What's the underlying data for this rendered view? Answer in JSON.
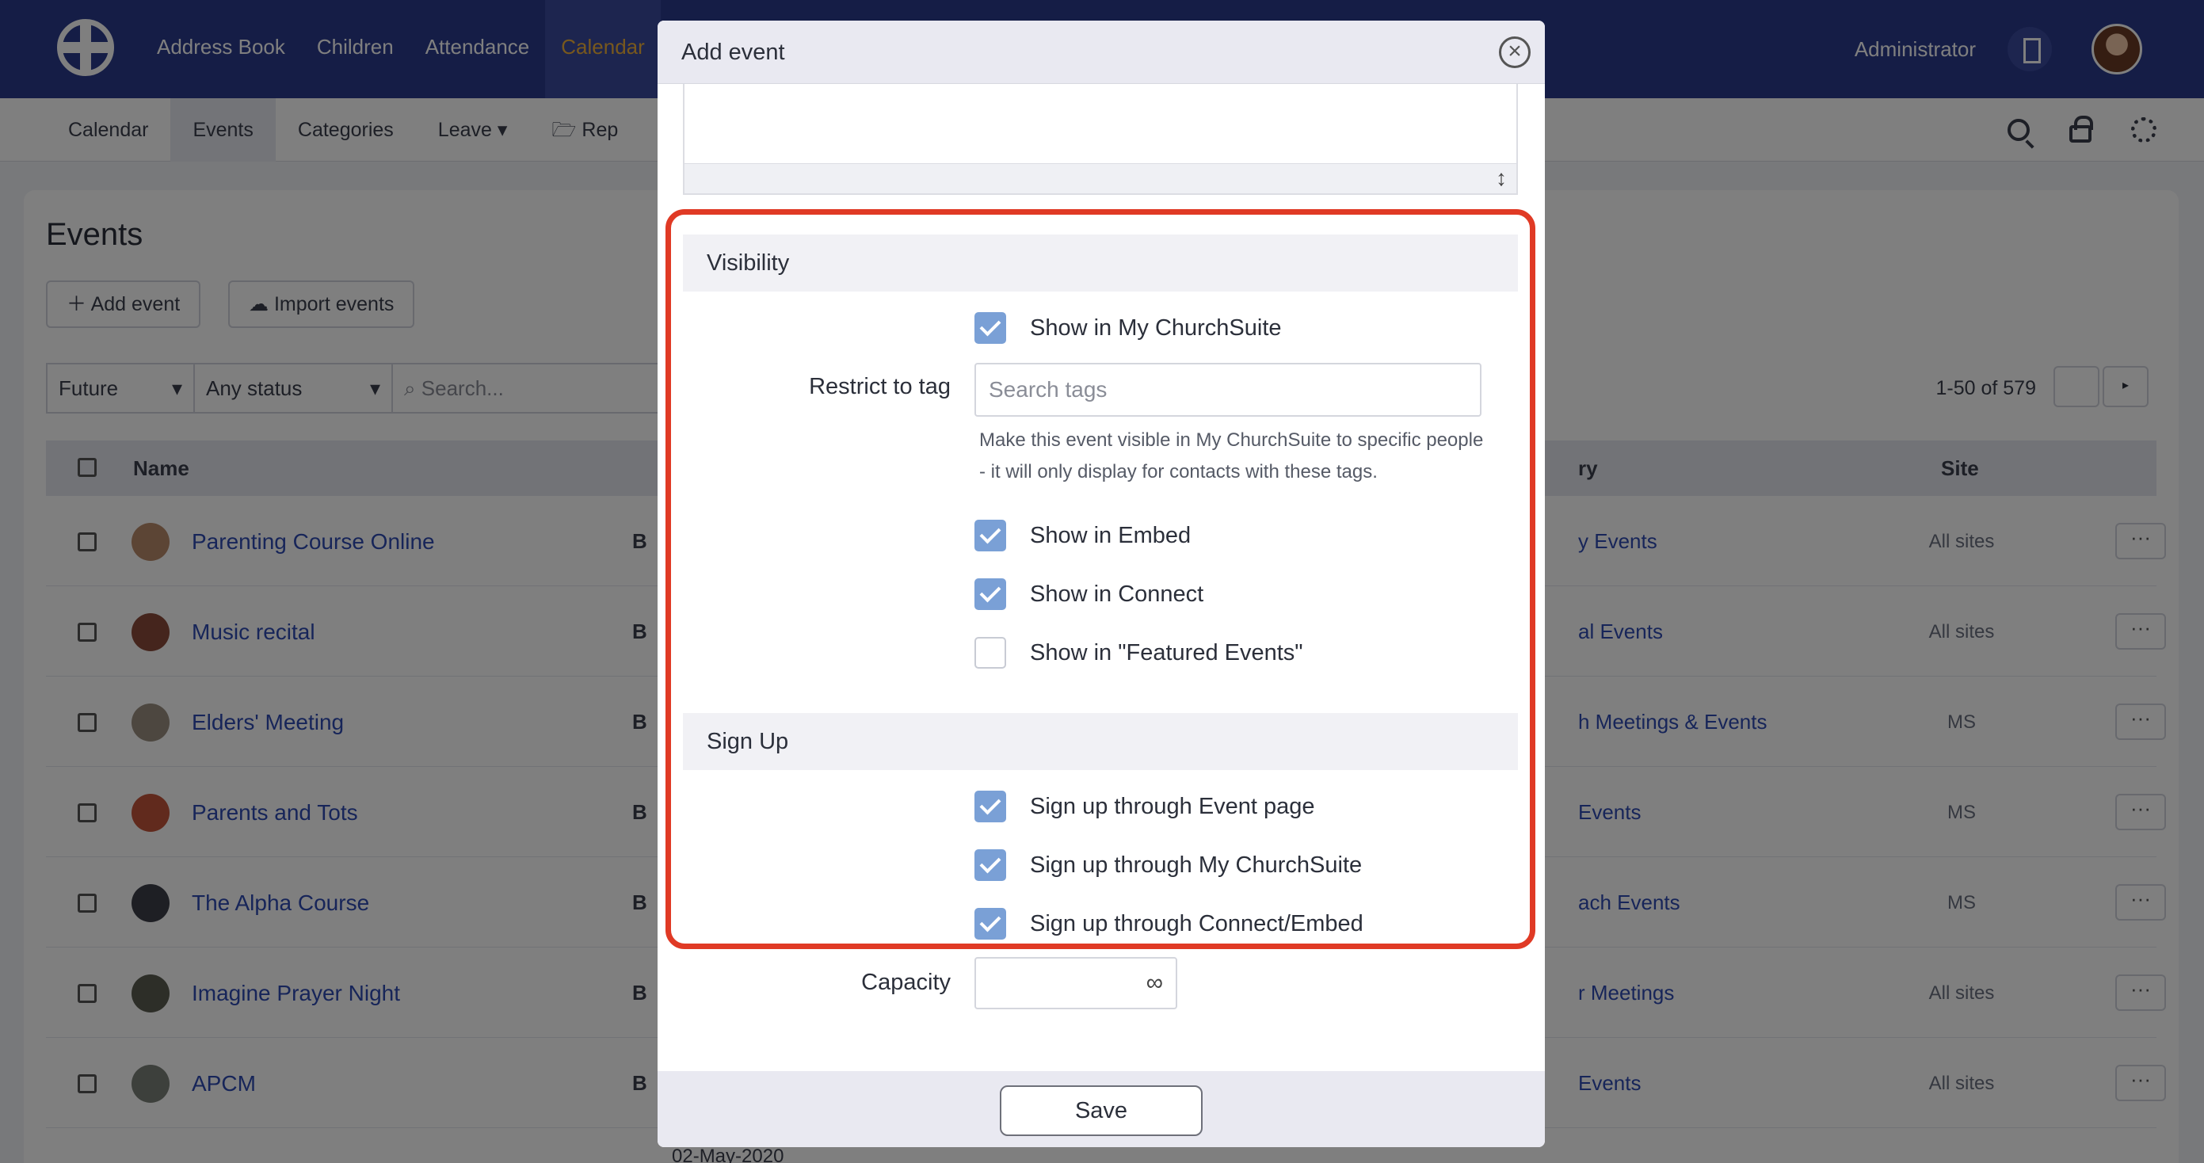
{
  "topbar": {
    "nav": [
      "Address Book",
      "Children",
      "Attendance",
      "Calendar"
    ],
    "active_nav": "Calendar",
    "user_label": "Administrator"
  },
  "subnav": {
    "items": [
      "Calendar",
      "Events",
      "Categories",
      "Leave",
      "Rep"
    ],
    "active": "Events"
  },
  "page": {
    "title": "Events",
    "add_event_label": "Add event",
    "import_events_label": "Import events",
    "filter_time": "Future",
    "filter_status": "Any status",
    "search_placeholder": "Search...",
    "paging": "1-50 of 579",
    "columns": {
      "name": "Name",
      "category": "ry",
      "site": "Site"
    },
    "rows": [
      {
        "name": "Parenting Course Online",
        "b": "B",
        "category": "y Events",
        "site": "All sites"
      },
      {
        "name": "Music recital",
        "b": "B",
        "category": "al Events",
        "site": "All sites"
      },
      {
        "name": "Elders' Meeting",
        "b": "B",
        "category": "h Meetings & Events",
        "site": "MS"
      },
      {
        "name": "Parents and Tots",
        "b": "B",
        "category": "Events",
        "site": "MS"
      },
      {
        "name": "The Alpha Course",
        "b": "B",
        "category": "ach Events",
        "site": "MS"
      },
      {
        "name": "Imagine Prayer Night",
        "b": "B",
        "category": "r Meetings",
        "site": "All sites"
      },
      {
        "name": "APCM",
        "b": "B",
        "category": "Events",
        "site": "All sites"
      }
    ],
    "more_label": "···",
    "date_peek": "02-May-2020"
  },
  "modal": {
    "title": "Add event",
    "close_glyph": "×",
    "resize_glyph": "↕",
    "visibility": {
      "heading": "Visibility",
      "show_mychurchsuite": "Show in My ChurchSuite",
      "restrict_label": "Restrict to tag",
      "tag_placeholder": "Search tags",
      "help_text": "Make this event visible in My ChurchSuite to specific people - it will only display for contacts with these tags.",
      "show_embed": "Show in Embed",
      "show_connect": "Show in Connect",
      "show_featured": "Show in \"Featured Events\""
    },
    "signup": {
      "heading": "Sign Up",
      "event_page": "Sign up through Event page",
      "mychurchsuite": "Sign up through My ChurchSuite",
      "connect_embed": "Sign up through Connect/Embed"
    },
    "capacity_label": "Capacity",
    "capacity_glyph": "∞",
    "save_label": "Save"
  },
  "colors": {
    "topbar": "#2a3a8c",
    "active_nav_text": "#f0b13a",
    "checkbox": "#7aa0d6",
    "highlight": "#e03a25",
    "link": "#2f4bb3"
  }
}
